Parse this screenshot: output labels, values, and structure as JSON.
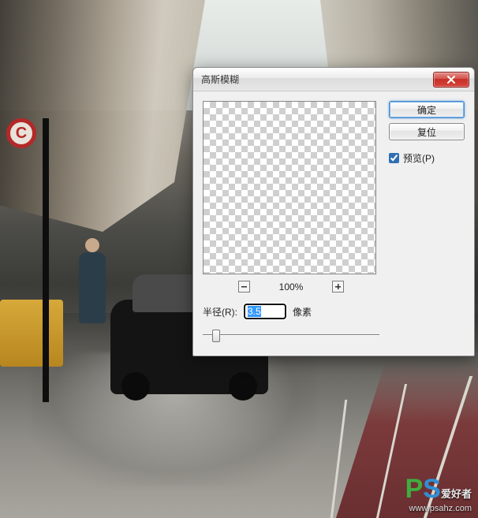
{
  "dialog": {
    "title": "高斯模糊",
    "ok_label": "确定",
    "reset_label": "复位",
    "preview_checkbox_label": "预览(P)",
    "preview_checked": true,
    "zoom_level": "100%",
    "radius_label": "半径(R):",
    "radius_value": "3.5",
    "radius_unit": "像素"
  },
  "sign": {
    "letter": "C"
  },
  "watermark": {
    "logo_p": "P",
    "logo_s": "S",
    "cn": "爱好者",
    "url": "www.psahz.com"
  }
}
